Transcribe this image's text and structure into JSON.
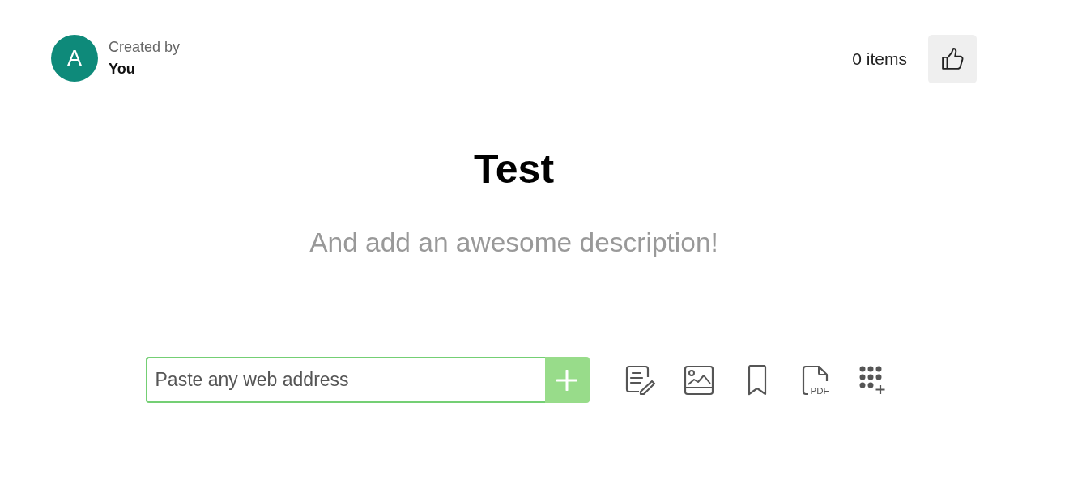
{
  "header": {
    "avatar_initial": "A",
    "creator_label": "Created by",
    "creator_name": "You",
    "items_count": "0 items"
  },
  "title": "Test",
  "description": {
    "placeholder": "And add an awesome description!"
  },
  "link_input": {
    "placeholder": "Paste any web address"
  },
  "tools": [
    {
      "kind": "note"
    },
    {
      "kind": "image"
    },
    {
      "kind": "bookmark"
    },
    {
      "kind": "pdf",
      "label": "PDF"
    },
    {
      "kind": "apps"
    }
  ]
}
